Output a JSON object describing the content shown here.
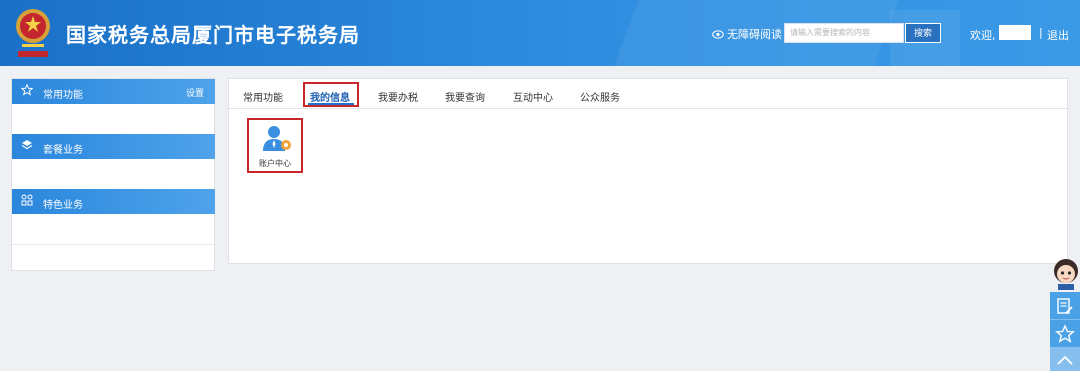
{
  "header": {
    "site_title": "国家税务总局厦门市电子税务局",
    "accessibility_label": "无障碍阅读",
    "search_placeholder": "请输入需要搜索的内容",
    "search_button": "搜索",
    "welcome": "欢迎,",
    "separator": "|",
    "logout": "退出",
    "emblem_icon": "tax-emblem-icon",
    "colors": {
      "header_gradient_start": "#1a70c7",
      "header_gradient_end": "#3a9ae6"
    }
  },
  "sidebar": {
    "sections": [
      {
        "label": "常用功能",
        "icon": "star-outline-icon",
        "setting_label": "设置"
      },
      {
        "label": "套餐业务",
        "icon": "layers-icon"
      },
      {
        "label": "特色业务",
        "icon": "grid-icon"
      }
    ]
  },
  "main": {
    "tabs": [
      {
        "label": "常用功能"
      },
      {
        "label": "我的信息",
        "active": true
      },
      {
        "label": "我要办税"
      },
      {
        "label": "我要查询"
      },
      {
        "label": "互动中心"
      },
      {
        "label": "公众服务"
      }
    ],
    "apps": [
      {
        "label": "账户中心",
        "icon": "user-gear-icon"
      }
    ],
    "colors": {
      "highlight_border": "#c9262c",
      "active_tab": "#1d5fb0"
    }
  },
  "float_bar": {
    "items": [
      {
        "icon": "assistant-avatar-icon"
      },
      {
        "icon": "edit-document-icon"
      },
      {
        "icon": "star-outline-icon"
      },
      {
        "icon": "chevron-up-icon"
      }
    ]
  }
}
